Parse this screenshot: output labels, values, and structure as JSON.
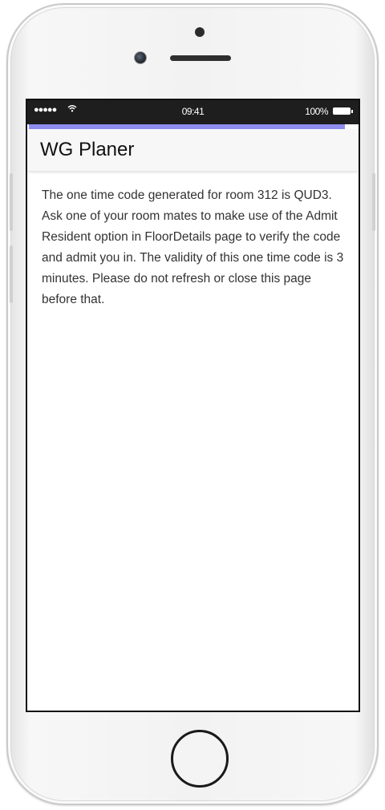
{
  "status_bar": {
    "signal": "●●●●●",
    "time": "09:41",
    "battery_percent": "100%"
  },
  "app": {
    "title": "WG Planer",
    "accent_color": "#8f8cf0"
  },
  "message": {
    "text": "The one time code generated for room 312 is QUD3. Ask one of your room mates to make use of the Admit Resident option in FloorDetails page to verify the code and admit you in. The validity of this one time code is 3 minutes. Please do not refresh or close this page before that."
  },
  "icons": {
    "wifi": "wifi-icon",
    "battery": "battery-icon",
    "signal": "signal-dots-icon"
  }
}
